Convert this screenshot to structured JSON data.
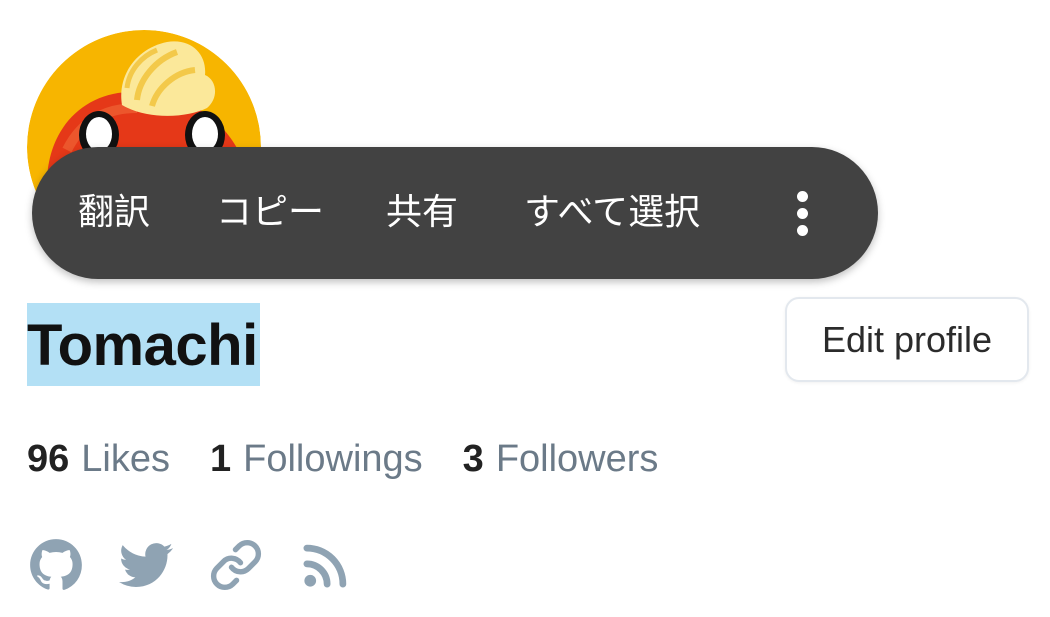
{
  "profile": {
    "avatar_icon": "avatar-image",
    "name": "Tomachi",
    "edit_button_label": "Edit profile"
  },
  "selection_toolbar": {
    "translate_label": "翻訳",
    "copy_label": "コピー",
    "share_label": "共有",
    "select_all_label": "すべて選択",
    "more_icon": "more-vertical-icon"
  },
  "stats": {
    "likes_count": "96",
    "likes_label": "Likes",
    "followings_count": "1",
    "followings_label": "Followings",
    "followers_count": "3",
    "followers_label": "Followers"
  },
  "social_links": [
    {
      "icon": "github-icon"
    },
    {
      "icon": "twitter-icon"
    },
    {
      "icon": "link-icon"
    },
    {
      "icon": "rss-icon"
    }
  ],
  "colors": {
    "toolbar_background": "#424242",
    "selection_highlight": "#b3e0f5",
    "muted_text": "#6b7a88",
    "icon_color": "#8fa3b3",
    "avatar_background": "#f7b500",
    "avatar_character": "#e53818"
  }
}
